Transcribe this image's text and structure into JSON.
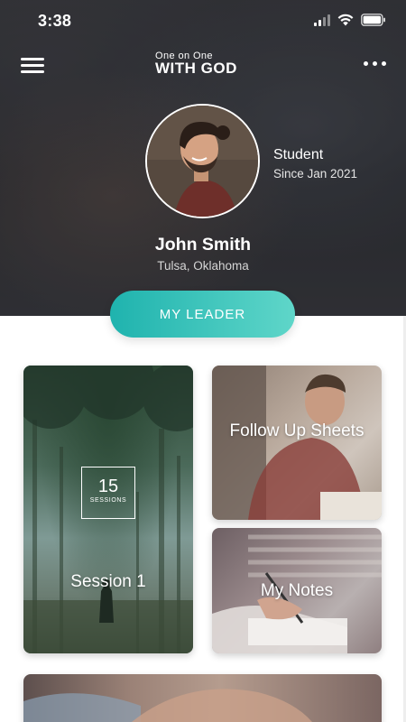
{
  "status_bar": {
    "time": "3:38"
  },
  "app": {
    "logo_line1": "One on One",
    "logo_line2": "WITH GOD"
  },
  "profile": {
    "role": "Student",
    "since": "Since Jan 2021",
    "name": "John Smith",
    "location": "Tulsa, Oklahoma"
  },
  "leader_button": {
    "label": "MY LEADER"
  },
  "cards": {
    "session": {
      "count": "15",
      "count_label": "SESSIONS",
      "label": "Session 1"
    },
    "followup": {
      "label": "Follow Up Sheets"
    },
    "notes": {
      "label": "My Notes"
    }
  },
  "colors": {
    "accent_start": "#1fb3ae",
    "accent_end": "#5fd6c9",
    "header_bg": "#2e3034"
  },
  "icons": {
    "menu": "hamburger-menu-icon",
    "more": "more-dots-icon",
    "signal": "cellular-signal-icon",
    "wifi": "wifi-icon",
    "battery": "battery-icon"
  }
}
